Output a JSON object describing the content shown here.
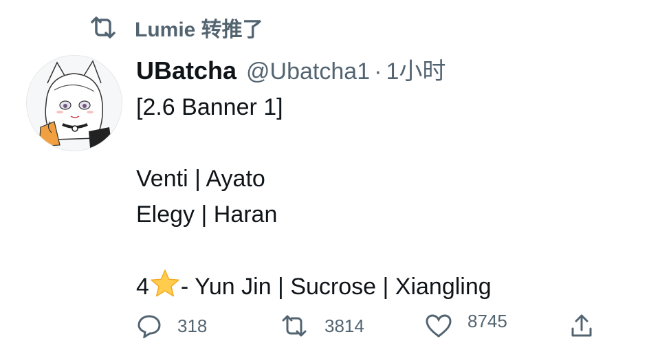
{
  "retweet": {
    "icon": "retweet-icon",
    "text": "Lumie 转推了"
  },
  "tweet": {
    "avatar_icon": "avatar-anime-girl",
    "display_name": "UBatcha",
    "handle": "@Ubatcha1",
    "separator": "·",
    "time": "1小时",
    "lines": {
      "l1": "[2.6 Banner 1]",
      "l2": "Venti | Ayato",
      "l3": "Elegy | Haran",
      "l4_prefix": "4",
      "l4_icon": "star-emoji-icon",
      "l4_suffix": "- Yun Jin | Sucrose | Xiangling"
    }
  },
  "actions": {
    "reply": {
      "icon": "reply-icon",
      "count": "318"
    },
    "retweet": {
      "icon": "retweet-icon",
      "count": "3814"
    },
    "like": {
      "icon": "heart-icon",
      "count": "8745"
    },
    "share": {
      "icon": "share-icon"
    }
  },
  "colors": {
    "text": "#0f1419",
    "secondary": "#536471",
    "star": "#ffcc4d"
  }
}
